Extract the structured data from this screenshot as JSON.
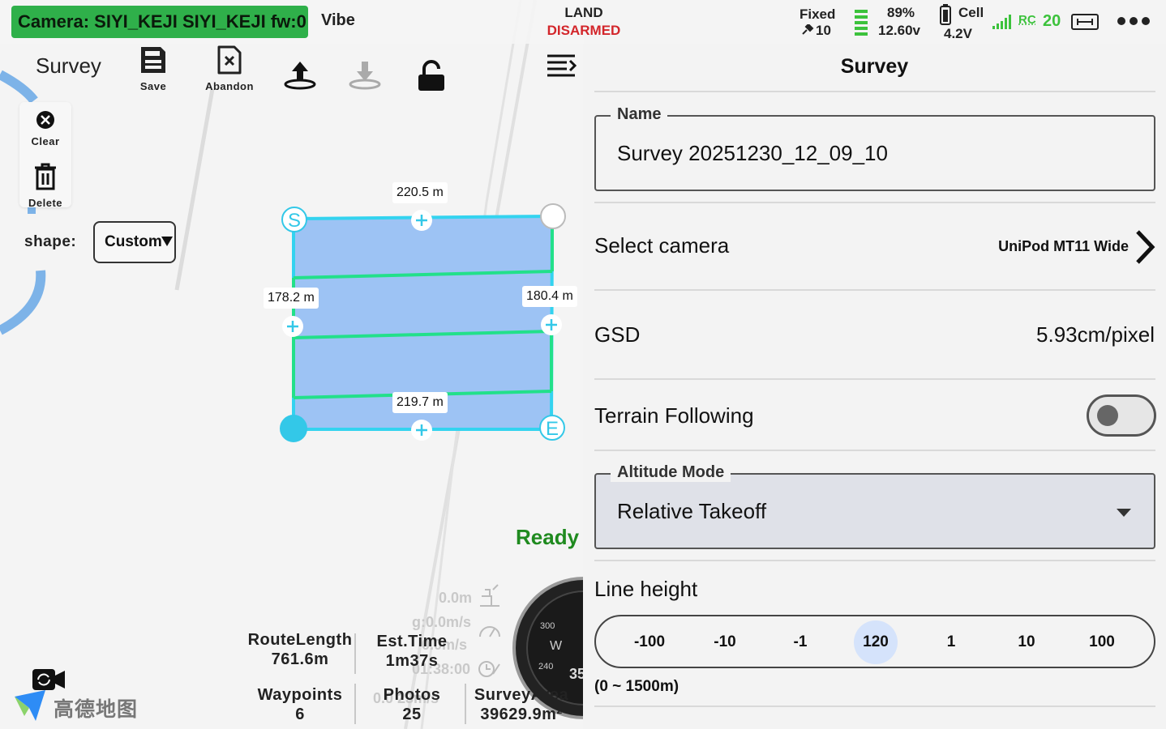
{
  "status_bar": {
    "camera_banner": "Camera: SIYI_KEJI SIYI_KEJI fw:0",
    "vibe": "Vibe",
    "flight_mode": "LAND",
    "arm_state": "DISARMED",
    "gps_fix": "Fixed",
    "gps_sats": "10",
    "battery_percent": "89%",
    "battery_voltage": "12.60v",
    "cell_label": "Cell",
    "cell_voltage": "4.2V",
    "rc_label": "RC",
    "rc_count": "20",
    "colors": {
      "camera_banner": "#2fb04a",
      "arm_state": "#d3262b",
      "rc": "#3cc23c",
      "ready": "#1f8a1f"
    }
  },
  "toolbar": {
    "title": "Survey",
    "save_label": "Save",
    "abandon_label": "Abandon",
    "upload_icon": "upload-icon",
    "download_icon": "download-icon",
    "lock_icon": "lock-icon",
    "menu_icon": "menu-icon"
  },
  "side_tools": {
    "clear_label": "Clear",
    "delete_label": "Delete",
    "shape_label": "shape:",
    "shape_value": "Custom"
  },
  "survey_polygon": {
    "start_marker": "S",
    "end_marker": "E",
    "edge_top": "220.5 m",
    "edge_left": "178.2 m",
    "edge_right": "180.4 m",
    "edge_bottom": "219.7 m"
  },
  "map_overlay": {
    "ready": "Ready",
    "altitude": "0.0m",
    "ground_speed": "g:0.0m/s",
    "vertical_speed": "0.0m/s",
    "flight_time": "01:38:00",
    "extra": "0.0 23m/s",
    "compass_west": "W",
    "compass_300": "300",
    "compass_240": "240",
    "compass_heading": "35",
    "map_provider": "高德地图"
  },
  "stats": {
    "route_length_label": "RouteLength",
    "route_length_value": "761.6m",
    "est_time_label": "Est.Time",
    "est_time_value": "1m37s",
    "waypoints_label": "Waypoints",
    "waypoints_value": "6",
    "photos_label": "Photos",
    "photos_value": "25",
    "survey_area_label": "SurveyArea",
    "survey_area_value": "39629.9m²"
  },
  "settings": {
    "title": "Survey",
    "name_label": "Name",
    "name_value": "Survey 20251230_12_09_10",
    "camera_label": "Select camera",
    "camera_value": "UniPod MT11 Wide",
    "gsd_label": "GSD",
    "gsd_value": "5.93cm/pixel",
    "terrain_label": "Terrain Following",
    "terrain_enabled": false,
    "altitude_mode_label": "Altitude Mode",
    "altitude_mode_value": "Relative Takeoff",
    "line_height_label": "Line height",
    "line_height_steps": [
      "-100",
      "-10",
      "-1",
      "120",
      "1",
      "10",
      "100"
    ],
    "line_height_current": "120",
    "line_height_range": "(0 ~ 1500m)",
    "highlight_color": "#d5e3fb"
  }
}
